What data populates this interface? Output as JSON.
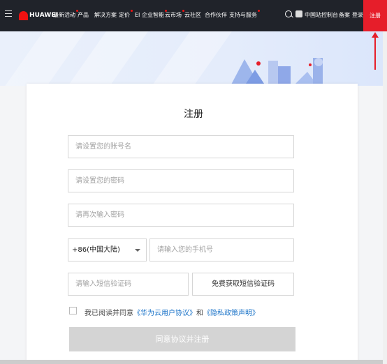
{
  "nav": {
    "logo_text": "HUAWEI",
    "items": [
      {
        "label": "最新活动",
        "dot": true
      },
      {
        "label": "产品",
        "dot": false
      },
      {
        "label": "解决方案",
        "dot": false
      },
      {
        "label": "定价",
        "dot": true
      },
      {
        "label": "EI 企业智能",
        "dot": true
      },
      {
        "label": "云市场",
        "dot": true
      },
      {
        "label": "云社区",
        "dot": false
      },
      {
        "label": "合作伙伴",
        "dot": false
      },
      {
        "label": "支持与服务",
        "dot": true
      }
    ],
    "right": {
      "region": "中国站",
      "console": "控制台",
      "filing": "备案",
      "login": "登录",
      "register": "注册"
    }
  },
  "form": {
    "title": "注册",
    "account_placeholder": "请设置您的账号名",
    "password_placeholder": "请设置您的密码",
    "password_confirm_placeholder": "请再次输入密码",
    "country_code": "+86(中国大陆)",
    "phone_placeholder": "请输入您的手机号",
    "sms_placeholder": "请输入短信验证码",
    "get_code_label": "免费获取短信验证码",
    "agree_prefix": "我已阅读并同意",
    "agreement_link": "《华为云用户协议》",
    "and": "和",
    "privacy_link": "《隐私政策声明》",
    "submit_label": "同意协议并注册"
  },
  "colors": {
    "accent": "#e61e2a",
    "link": "#1a73c8",
    "nav_bg": "#20232a"
  }
}
